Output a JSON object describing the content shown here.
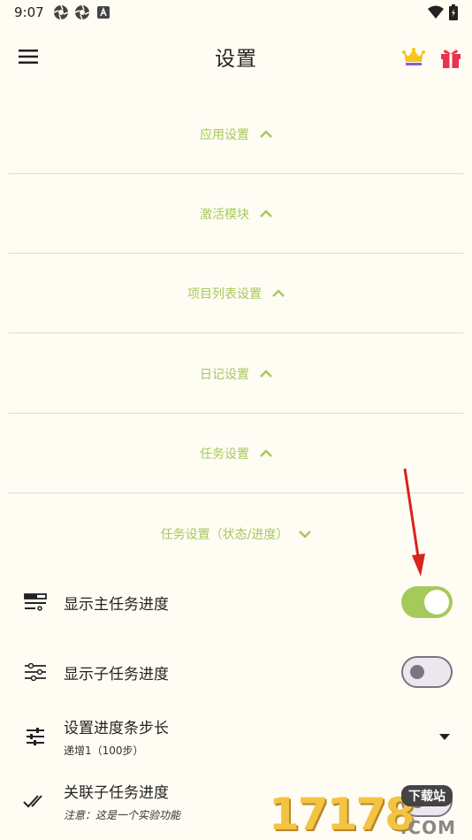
{
  "status_bar": {
    "time": "9:07",
    "icons": [
      "aperture-icon",
      "aperture-icon",
      "a-box-icon"
    ],
    "right_icons": [
      "wifi-icon",
      "battery-icon"
    ]
  },
  "app_bar": {
    "title": "设置",
    "menu_icon": "hamburger-menu-icon",
    "crown_icon": "crown-icon",
    "gift_icon": "gift-icon"
  },
  "sections": [
    {
      "label": "应用设置",
      "state": "collapsed"
    },
    {
      "label": "激活模块",
      "state": "collapsed"
    },
    {
      "label": "项目列表设置",
      "state": "collapsed"
    },
    {
      "label": "日记设置",
      "state": "collapsed"
    },
    {
      "label": "任务设置",
      "state": "collapsed"
    },
    {
      "label": "任务设置（状态/进度）",
      "state": "expanded"
    }
  ],
  "rows": [
    {
      "icon": "progress-bars-icon",
      "title": "显示主任务进度",
      "subtitle": "",
      "control": "switch",
      "value": "on"
    },
    {
      "icon": "sliders-icon",
      "title": "显示子任务进度",
      "subtitle": "",
      "control": "switch",
      "value": "off"
    },
    {
      "icon": "tune-icon",
      "title": "设置进度条步长",
      "subtitle": "递增1（100步）",
      "control": "dropdown"
    },
    {
      "icon": "double-check-icon",
      "title": "关联子任务进度",
      "subtitle": "注意：这是一个实验功能",
      "control": "switch",
      "value": "off"
    }
  ],
  "watermark": {
    "digits": "17178",
    "badge": "下载站",
    "com": ".COM"
  },
  "colors": {
    "background": "#fffcf3",
    "accent": "#a6c95c",
    "divider": "#dcdad2",
    "switch_off": "#7b7481",
    "arrow": "#d8231f"
  }
}
